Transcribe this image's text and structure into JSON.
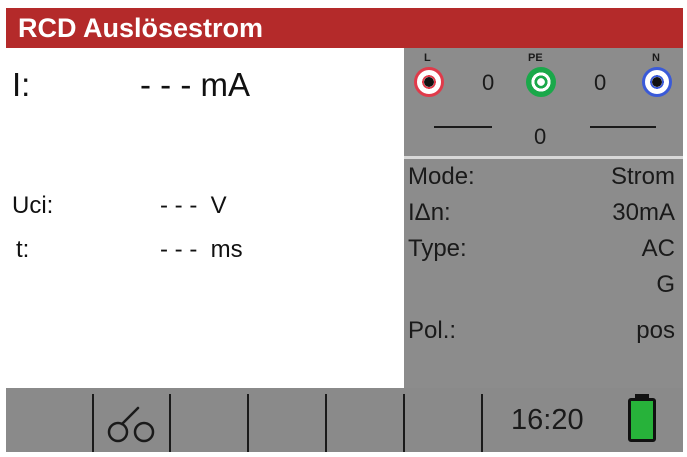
{
  "title": "RCD Auslösestrom",
  "measurement": {
    "current": {
      "label": "I:",
      "value": "- - - mA"
    },
    "uci": {
      "label": "Uci:",
      "value": "- - -  V"
    },
    "time": {
      "label": "t:",
      "value": "- - -  ms"
    }
  },
  "terminals": {
    "l_label": "L",
    "pe_label": "PE",
    "n_label": "N",
    "l_pe_value": "0",
    "pe_n_value": "0",
    "l_n_value": "0",
    "colors": {
      "l": "#e03a4a",
      "pe": "#1aa84a",
      "n": "#3a5ad8"
    }
  },
  "params": [
    {
      "label": "Mode:",
      "value": "Strom"
    },
    {
      "label": "IΔn:",
      "value": "30mA"
    },
    {
      "label": "Type:",
      "value": "AC"
    },
    {
      "label": "",
      "value": "G"
    },
    {
      "label": "Pol.:",
      "value": "pos"
    }
  ],
  "status": {
    "time": "16:20",
    "battery_level": 1.0,
    "battery_color": "#27b23a"
  },
  "icons": {
    "probe": "probe-switch-icon",
    "battery": "battery-icon"
  }
}
